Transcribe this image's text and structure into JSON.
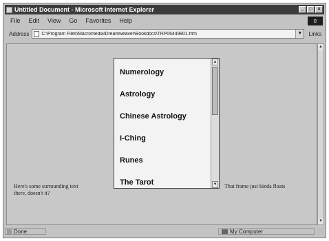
{
  "window": {
    "title": "Untitled Document - Microsoft Internet Explorer",
    "icons": {
      "app": "ie-app-icon",
      "minimize": "minimize-icon",
      "maximize": "maximize-icon",
      "close": "close-icon"
    }
  },
  "menu": {
    "items": [
      "File",
      "Edit",
      "View",
      "Go",
      "Favorites",
      "Help"
    ]
  },
  "address": {
    "label": "Address",
    "value": "C:\\Program Files\\Macromedia\\Dreamweaver\\Bookdocs\\TRP06449901.htm",
    "links_label": "Links"
  },
  "content": {
    "text_left": "Here's some surrounding text",
    "text_right": "That frame just kinda floats",
    "text_left_2": "there, doesn't it?",
    "iframe_items": [
      "Numerology",
      "Astrology",
      "Chinese Astrology",
      "I-Ching",
      "Runes",
      "The Tarot"
    ]
  },
  "status": {
    "left": "Done",
    "zone": "My Computer"
  }
}
